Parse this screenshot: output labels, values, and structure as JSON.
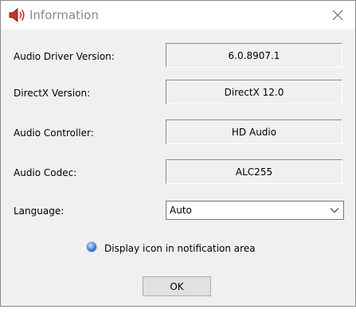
{
  "window": {
    "title": "Information",
    "title_icon": "speaker-icon",
    "close_icon": "close-icon"
  },
  "fields": [
    {
      "label": "Audio Driver Version:",
      "value": "6.0.8907.1"
    },
    {
      "label": "DirectX Version:",
      "value": "DirectX 12.0"
    },
    {
      "label": "Audio Controller:",
      "value": "HD Audio"
    },
    {
      "label": "Audio Codec:",
      "value": "ALC255"
    }
  ],
  "language": {
    "label": "Language:",
    "selected": "Auto",
    "arrow_icon": "chevron-down-icon"
  },
  "notification": {
    "label": "Display icon in notification area",
    "selected": true
  },
  "buttons": {
    "ok_label": "OK"
  },
  "colors": {
    "dialog_background": "#f0f0f0",
    "title_text": "#8a8a8a",
    "speaker_red": "#c8312a",
    "radio_blue": "#3a7bd5"
  }
}
